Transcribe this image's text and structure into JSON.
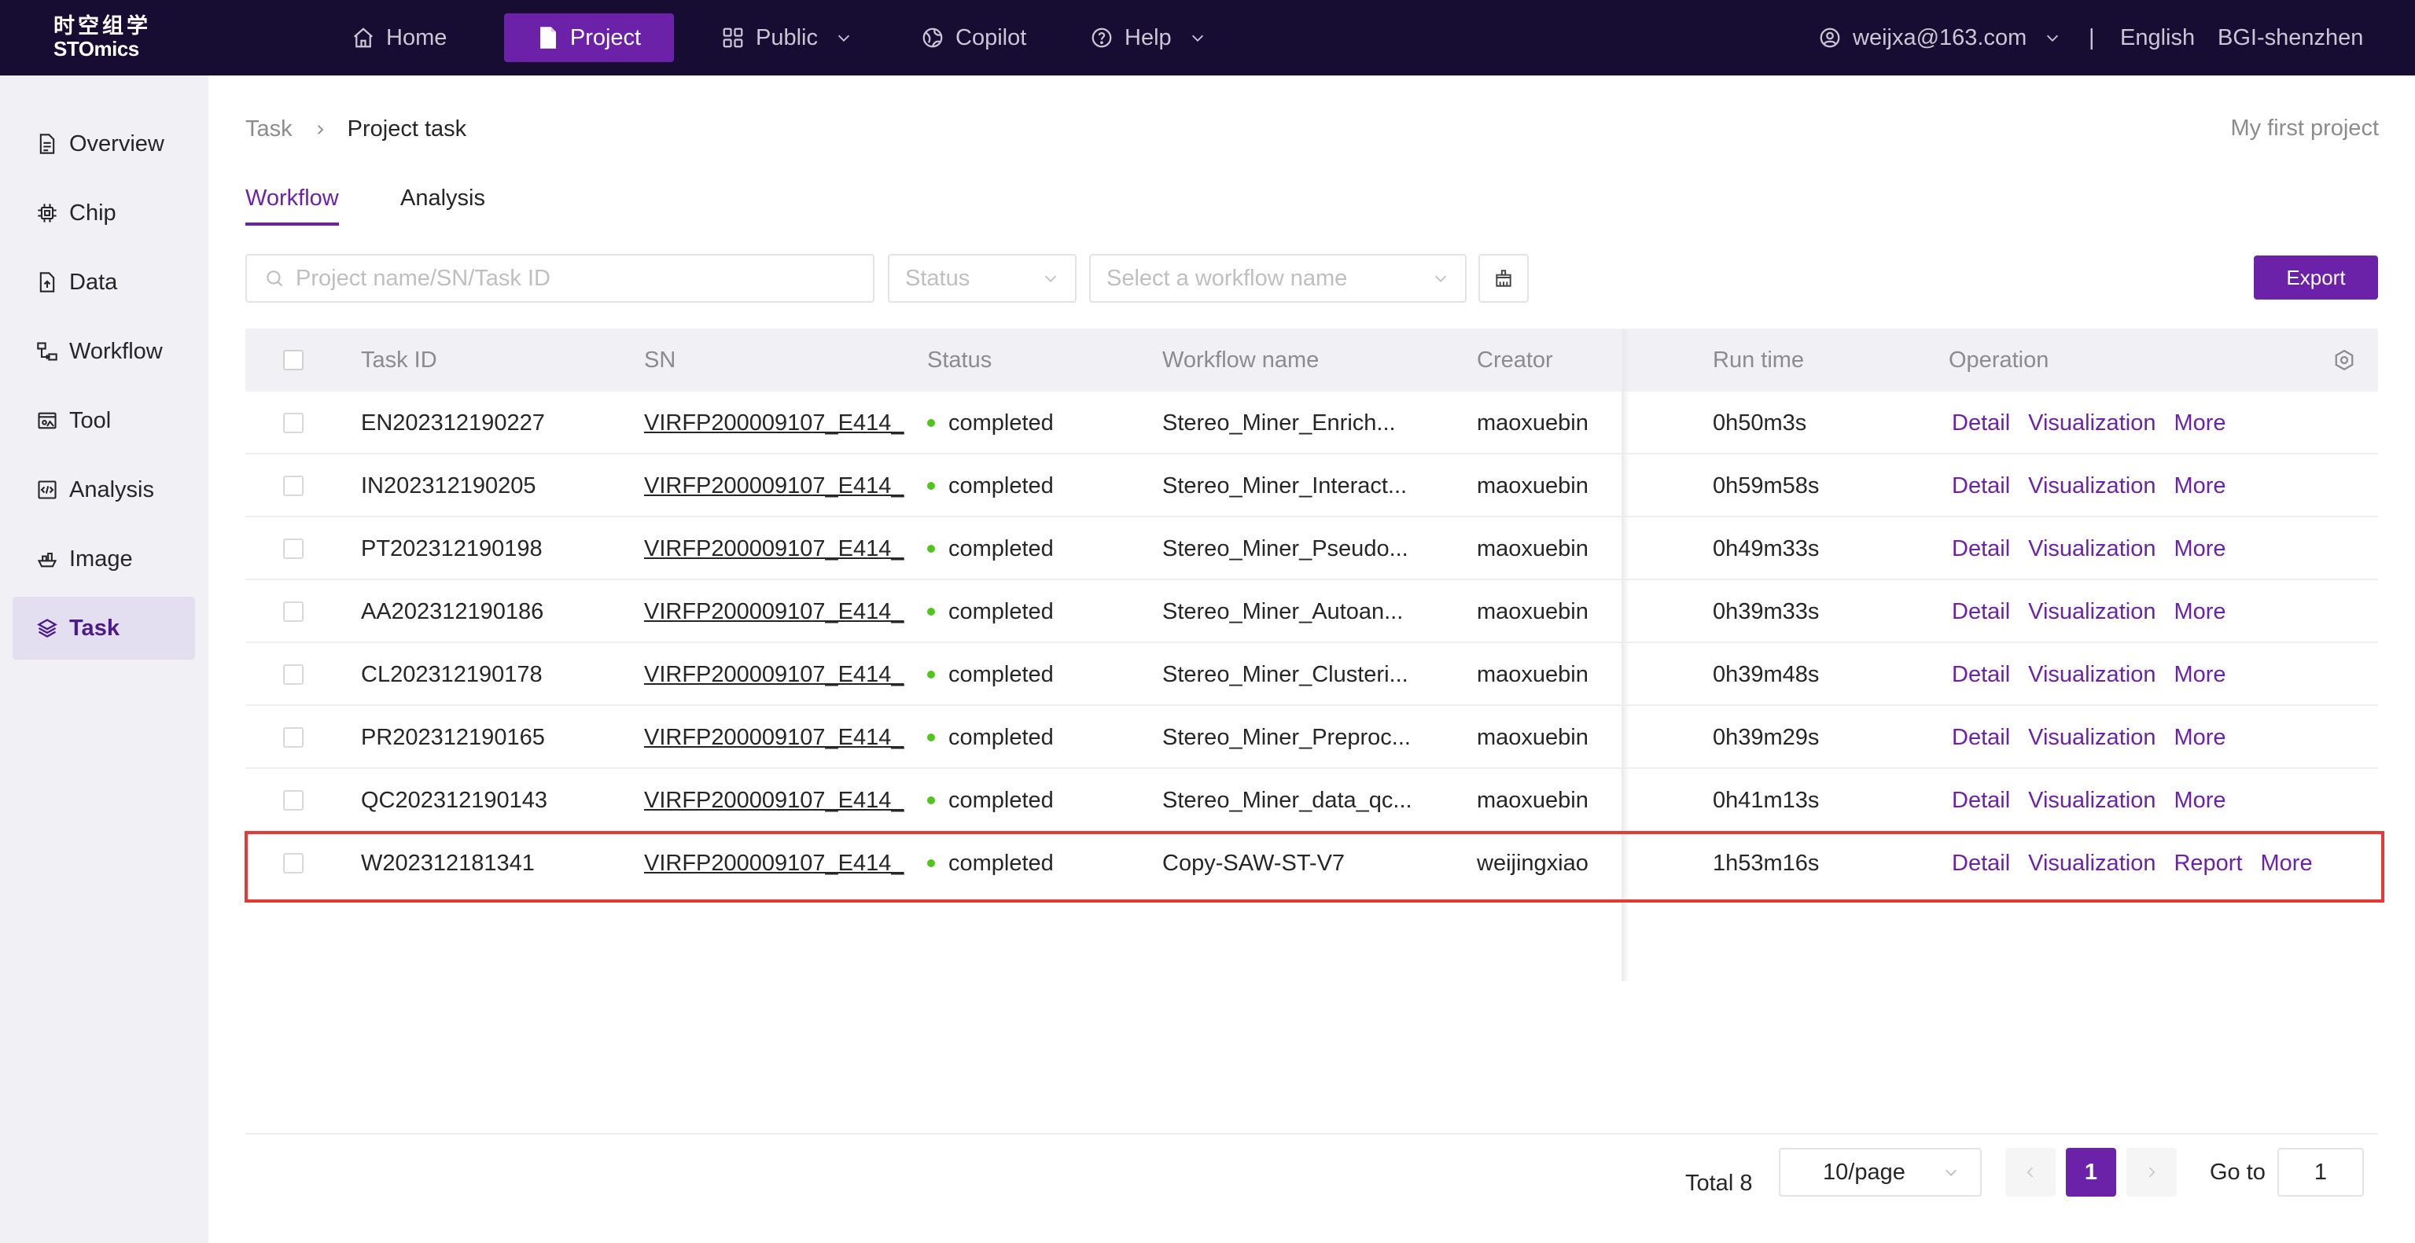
{
  "app": {
    "logo_cn": "时空组学",
    "logo_en": "STOmics",
    "nav": [
      {
        "label": "Home",
        "icon": "home-icon"
      },
      {
        "label": "Project",
        "icon": "document-icon",
        "active": true
      },
      {
        "label": "Public",
        "icon": "grid-icon",
        "dropdown": true
      },
      {
        "label": "Copilot",
        "icon": "globe-icon"
      },
      {
        "label": "Help",
        "icon": "help-icon",
        "dropdown": true
      }
    ],
    "user": "weijxa@163.com",
    "separator": "|",
    "language": "English",
    "region": "BGI-shenzhen",
    "accent_color": "#6c22a8",
    "topbar_color": "#170d33"
  },
  "sidebar": {
    "items": [
      {
        "label": "Overview",
        "icon": "file-icon"
      },
      {
        "label": "Chip",
        "icon": "chip-icon"
      },
      {
        "label": "Data",
        "icon": "data-upload-icon"
      },
      {
        "label": "Workflow",
        "icon": "workflow-icon"
      },
      {
        "label": "Tool",
        "icon": "tool-icon"
      },
      {
        "label": "Analysis",
        "icon": "code-icon"
      },
      {
        "label": "Image",
        "icon": "image-icon"
      },
      {
        "label": "Task",
        "icon": "layers-icon",
        "active": true
      }
    ]
  },
  "breadcrumb": {
    "parent": "Task",
    "current": "Project task"
  },
  "project_name": "My first project",
  "tabs": [
    {
      "label": "Workflow",
      "active": true
    },
    {
      "label": "Analysis",
      "active": false
    }
  ],
  "filters": {
    "search_placeholder": "Project name/SN/Task ID",
    "status_placeholder": "Status",
    "workflow_placeholder": "Select a workflow name"
  },
  "export_label": "Export",
  "table": {
    "columns": [
      "Task ID",
      "SN",
      "Status",
      "Workflow name",
      "Creator",
      "Run time",
      "Operation"
    ],
    "rows": [
      {
        "task_id": "EN202312190227",
        "sn": "VIRFP200009107_E414_",
        "status": "completed",
        "workflow": "Stereo_Miner_Enrich...",
        "creator": "maoxuebin",
        "run_time": "0h50m3s",
        "ops": [
          "Detail",
          "Visualization",
          "More"
        ]
      },
      {
        "task_id": "IN202312190205",
        "sn": "VIRFP200009107_E414_",
        "status": "completed",
        "workflow": "Stereo_Miner_Interact...",
        "creator": "maoxuebin",
        "run_time": "0h59m58s",
        "ops": [
          "Detail",
          "Visualization",
          "More"
        ]
      },
      {
        "task_id": "PT202312190198",
        "sn": "VIRFP200009107_E414_",
        "status": "completed",
        "workflow": "Stereo_Miner_Pseudo...",
        "creator": "maoxuebin",
        "run_time": "0h49m33s",
        "ops": [
          "Detail",
          "Visualization",
          "More"
        ]
      },
      {
        "task_id": "AA202312190186",
        "sn": "VIRFP200009107_E414_",
        "status": "completed",
        "workflow": "Stereo_Miner_Autoan...",
        "creator": "maoxuebin",
        "run_time": "0h39m33s",
        "ops": [
          "Detail",
          "Visualization",
          "More"
        ]
      },
      {
        "task_id": "CL202312190178",
        "sn": "VIRFP200009107_E414_",
        "status": "completed",
        "workflow": "Stereo_Miner_Clusteri...",
        "creator": "maoxuebin",
        "run_time": "0h39m48s",
        "ops": [
          "Detail",
          "Visualization",
          "More"
        ]
      },
      {
        "task_id": "PR202312190165",
        "sn": "VIRFP200009107_E414_",
        "status": "completed",
        "workflow": "Stereo_Miner_Preproc...",
        "creator": "maoxuebin",
        "run_time": "0h39m29s",
        "ops": [
          "Detail",
          "Visualization",
          "More"
        ]
      },
      {
        "task_id": "QC202312190143",
        "sn": "VIRFP200009107_E414_",
        "status": "completed",
        "workflow": "Stereo_Miner_data_qc...",
        "creator": "maoxuebin",
        "run_time": "0h41m13s",
        "ops": [
          "Detail",
          "Visualization",
          "More"
        ]
      },
      {
        "task_id": "W202312181341",
        "sn": "VIRFP200009107_E414_",
        "status": "completed",
        "workflow": "Copy-SAW-ST-V7",
        "creator": "weijingxiao",
        "run_time": "1h53m16s",
        "ops": [
          "Detail",
          "Visualization",
          "Report",
          "More"
        ],
        "highlighted": true
      }
    ]
  },
  "pagination": {
    "total_label": "Total 8",
    "page_size": "10/page",
    "current_page": "1",
    "goto_label": "Go to",
    "goto_value": "1"
  }
}
